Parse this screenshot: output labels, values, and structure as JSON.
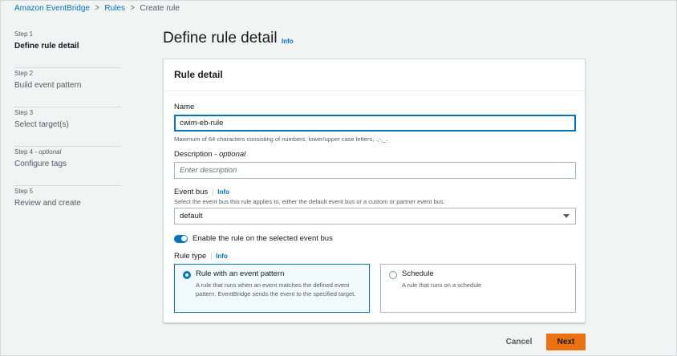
{
  "breadcrumb": {
    "items": [
      "Amazon EventBridge",
      "Rules"
    ],
    "current": "Create rule"
  },
  "steps": [
    {
      "num": "Step 1",
      "optional": "",
      "label": "Define rule detail",
      "active": true
    },
    {
      "num": "Step 2",
      "optional": "",
      "label": "Build event pattern",
      "active": false
    },
    {
      "num": "Step 3",
      "optional": "",
      "label": "Select target(s)",
      "active": false
    },
    {
      "num": "Step 4",
      "optional": " - optional",
      "label": "Configure tags",
      "active": false
    },
    {
      "num": "Step 5",
      "optional": "",
      "label": "Review and create",
      "active": false
    }
  ],
  "page": {
    "title": "Define rule detail",
    "info": "Info"
  },
  "panel": {
    "title": "Rule detail",
    "name": {
      "label": "Name",
      "value": "cwim-eb-rule",
      "hint": "Maximum of 64 characters consisting of numbers, lower/upper case letters, .,-,_."
    },
    "description": {
      "label": "Description",
      "optional": " - optional",
      "placeholder": "Enter description"
    },
    "event_bus": {
      "label": "Event bus",
      "info": "Info",
      "hint": "Select the event bus this rule applies to, either the default event bus or a custom or partner event bus.",
      "value": "default"
    },
    "toggle": {
      "label": "Enable the rule on the selected event bus",
      "on": true
    },
    "rule_type": {
      "label": "Rule type",
      "info": "Info",
      "options": [
        {
          "title": "Rule with an event pattern",
          "desc": "A rule that runs when an event matches the defined event pattern. EventBridge sends the event to the specified target.",
          "selected": true
        },
        {
          "title": "Schedule",
          "desc": "A rule that runs on a schedule",
          "selected": false
        }
      ]
    }
  },
  "actions": {
    "cancel": "Cancel",
    "next": "Next"
  },
  "colors": {
    "accent": "#0073bb",
    "primary_button": "#ec7211",
    "background": "#f2f3f3"
  }
}
